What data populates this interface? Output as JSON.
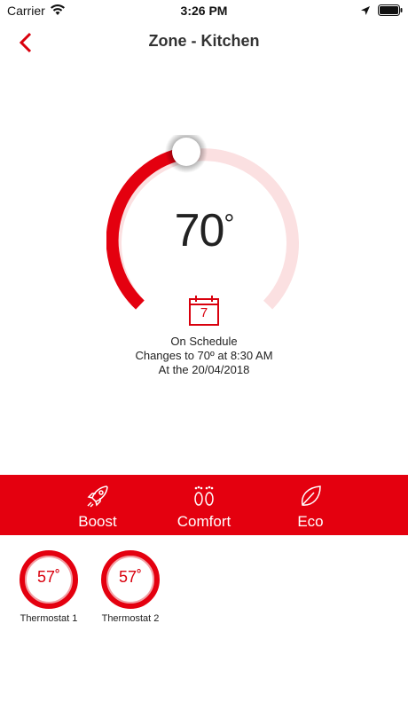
{
  "status_bar": {
    "carrier": "Carrier",
    "time": "3:26 PM",
    "icons": [
      "wifi-icon",
      "location-arrow-icon",
      "battery-icon"
    ]
  },
  "header": {
    "title": "Zone - Kitchen",
    "back_icon": "chevron-left-icon"
  },
  "dial": {
    "temperature": "70",
    "degree_symbol": "°",
    "level": 0.5,
    "calendar_day": "7",
    "icon": "calendar-icon"
  },
  "schedule": {
    "line1": "On Schedule",
    "line2": "Changes to 70º at 8:30 AM",
    "line3": "At the 20/04/2018"
  },
  "modes": [
    {
      "label": "Boost",
      "icon": "rocket-icon"
    },
    {
      "label": "Comfort",
      "icon": "footprints-icon"
    },
    {
      "label": "Eco",
      "icon": "leaf-icon"
    }
  ],
  "thermostats": [
    {
      "temp": "57",
      "degree": "˚",
      "label": "Thermostat 1"
    },
    {
      "temp": "57",
      "degree": "˚",
      "label": "Thermostat 2"
    }
  ],
  "colors": {
    "accent": "#e4000f",
    "accent_light": "#fbe0e1",
    "text": "#222222",
    "background": "#ffffff"
  }
}
